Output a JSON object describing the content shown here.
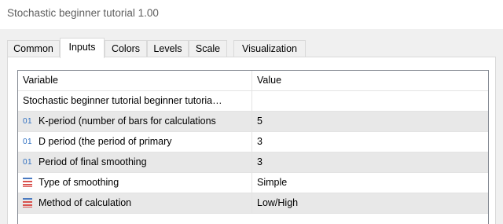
{
  "window": {
    "title": "Stochastic beginner tutorial 1.00"
  },
  "tabs": [
    {
      "label": "Common",
      "active": false
    },
    {
      "label": "Inputs",
      "active": true
    },
    {
      "label": "Colors",
      "active": false
    },
    {
      "label": "Levels",
      "active": false
    },
    {
      "label": "Scale",
      "active": false
    },
    {
      "label": "Visualization",
      "active": false
    }
  ],
  "table": {
    "headers": {
      "variable": "Variable",
      "value": "Value"
    },
    "rows": [
      {
        "icon": "",
        "variable": "Stochastic beginner tutorial beginner tutoria…",
        "value": ""
      },
      {
        "icon": "01",
        "variable": "K-period (number of bars for calculations",
        "value": "5"
      },
      {
        "icon": "01",
        "variable": "D period (the period of primary",
        "value": "3"
      },
      {
        "icon": "01",
        "variable": "Period of final smoothing",
        "value": "3"
      },
      {
        "icon": "enum-icon",
        "variable": "Type of smoothing",
        "value": "Simple"
      },
      {
        "icon": "enum-icon",
        "variable": "Method of calculation",
        "value": "Low/High"
      }
    ]
  },
  "colors": {
    "int_icon": "#2f6fc0",
    "enum_icon": "#d9534f",
    "row_shade": "#e8e8e8"
  }
}
